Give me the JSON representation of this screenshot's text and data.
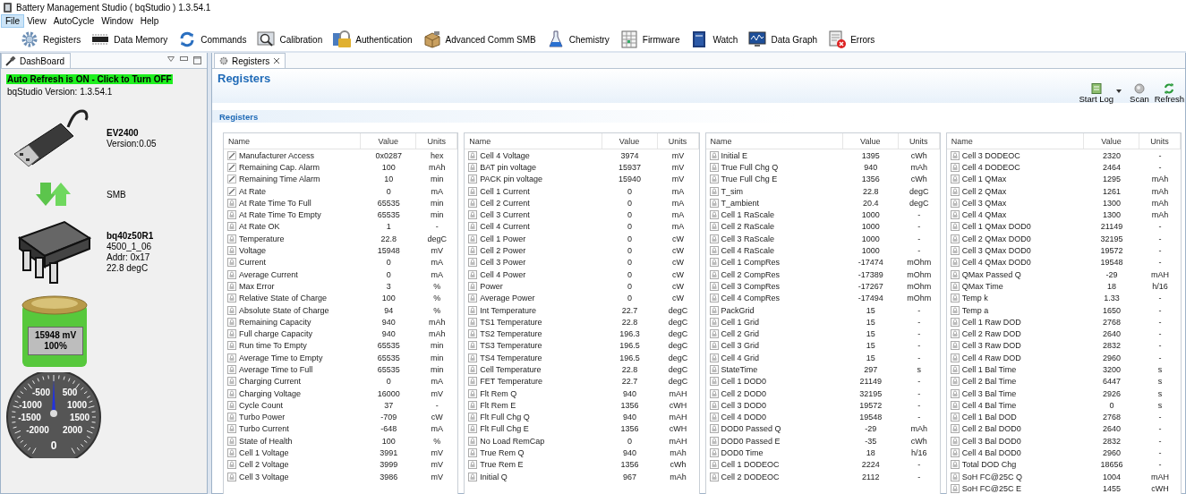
{
  "window": {
    "title": "Battery Management Studio ( bqStudio ) 1.3.54.1"
  },
  "menu": [
    {
      "label": "File",
      "highlighted": true
    },
    {
      "label": "View",
      "highlighted": false
    },
    {
      "label": "AutoCycle",
      "highlighted": false
    },
    {
      "label": "Window",
      "highlighted": false
    },
    {
      "label": "Help",
      "highlighted": false
    }
  ],
  "toolbar": [
    "Registers",
    "Data Memory",
    "Commands",
    "Calibration",
    "Authentication",
    "Advanced Comm SMB",
    "Chemistry",
    "Firmware",
    "Watch",
    "Data Graph",
    "Errors"
  ],
  "dashboard": {
    "tab": "DashBoard",
    "auto_refresh": "Auto Refresh is ON - Click to Turn OFF",
    "version": "bqStudio Version:  1.3.54.1",
    "adapter": {
      "name": "EV2400",
      "version": "Version:0.05"
    },
    "bus": "SMB",
    "device": {
      "name": "bq40z50R1",
      "lines": [
        "4500_1_06",
        "Addr: 0x17",
        "22.8 degC"
      ]
    },
    "battery": {
      "voltage": "15948 mV",
      "percent": "100%",
      "level": 1
    },
    "gauge": {
      "labels": [
        "-500",
        "500",
        "-1000",
        "1000",
        "-1500",
        "1500",
        "-2000",
        "2000"
      ],
      "reading": "0"
    }
  },
  "editor": {
    "tab": "Registers",
    "heading": "Registers",
    "actions": [
      "Start Log",
      "Scan",
      "Refresh"
    ],
    "section": "Registers",
    "tables": [
      {
        "columns": [
          "Name",
          "Value",
          "Units"
        ],
        "rows": [
          {
            "kind": "writable",
            "name": "Manufacturer Access",
            "value": "0x0287",
            "units": "hex"
          },
          {
            "kind": "writable",
            "name": "Remaining Cap. Alarm",
            "value": "100",
            "units": "mAh"
          },
          {
            "kind": "writable",
            "name": "Remaining Time Alarm",
            "value": "10",
            "units": "min"
          },
          {
            "kind": "writable",
            "name": "At Rate",
            "value": "0",
            "units": "mA"
          },
          {
            "kind": "readonly",
            "name": "At Rate Time To Full",
            "value": "65535",
            "units": "min"
          },
          {
            "kind": "readonly",
            "name": "At Rate Time To Empty",
            "value": "65535",
            "units": "min"
          },
          {
            "kind": "readonly",
            "name": "At Rate OK",
            "value": "1",
            "units": "-"
          },
          {
            "kind": "readonly",
            "name": "Temperature",
            "value": "22.8",
            "units": "degC"
          },
          {
            "kind": "readonly",
            "name": "Voltage",
            "value": "15948",
            "units": "mV"
          },
          {
            "kind": "readonly",
            "name": "Current",
            "value": "0",
            "units": "mA"
          },
          {
            "kind": "readonly",
            "name": "Average Current",
            "value": "0",
            "units": "mA"
          },
          {
            "kind": "readonly",
            "name": "Max Error",
            "value": "3",
            "units": "%"
          },
          {
            "kind": "readonly",
            "name": "Relative State of Charge",
            "value": "100",
            "units": "%"
          },
          {
            "kind": "readonly",
            "name": "Absolute State of Charge",
            "value": "94",
            "units": "%"
          },
          {
            "kind": "readonly",
            "name": "Remaining Capacity",
            "value": "940",
            "units": "mAh"
          },
          {
            "kind": "readonly",
            "name": "Full charge Capacity",
            "value": "940",
            "units": "mAh"
          },
          {
            "kind": "readonly",
            "name": "Run time To Empty",
            "value": "65535",
            "units": "min"
          },
          {
            "kind": "readonly",
            "name": "Average Time to Empty",
            "value": "65535",
            "units": "min"
          },
          {
            "kind": "readonly",
            "name": "Average Time to Full",
            "value": "65535",
            "units": "min"
          },
          {
            "kind": "readonly",
            "name": "Charging Current",
            "value": "0",
            "units": "mA"
          },
          {
            "kind": "readonly",
            "name": "Charging Voltage",
            "value": "16000",
            "units": "mV"
          },
          {
            "kind": "readonly",
            "name": "Cycle Count",
            "value": "37",
            "units": "-"
          },
          {
            "kind": "readonly",
            "name": "Turbo Power",
            "value": "-709",
            "units": "cW"
          },
          {
            "kind": "readonly",
            "name": "Turbo Current",
            "value": "-648",
            "units": "mA"
          },
          {
            "kind": "readonly",
            "name": "State of Health",
            "value": "100",
            "units": "%"
          },
          {
            "kind": "readonly",
            "name": "Cell 1 Voltage",
            "value": "3991",
            "units": "mV"
          },
          {
            "kind": "readonly",
            "name": "Cell 2 Voltage",
            "value": "3999",
            "units": "mV"
          },
          {
            "kind": "readonly",
            "name": "Cell 3 Voltage",
            "value": "3986",
            "units": "mV"
          }
        ]
      },
      {
        "columns": [
          "Name",
          "Value",
          "Units"
        ],
        "rows": [
          {
            "kind": "readonly",
            "name": "Cell 4 Voltage",
            "value": "3974",
            "units": "mV"
          },
          {
            "kind": "readonly",
            "name": "BAT pin voltage",
            "value": "15937",
            "units": "mV"
          },
          {
            "kind": "readonly",
            "name": "PACK pin voltage",
            "value": "15940",
            "units": "mV"
          },
          {
            "kind": "readonly",
            "name": "Cell 1 Current",
            "value": "0",
            "units": "mA"
          },
          {
            "kind": "readonly",
            "name": "Cell 2 Current",
            "value": "0",
            "units": "mA"
          },
          {
            "kind": "readonly",
            "name": "Cell 3 Current",
            "value": "0",
            "units": "mA"
          },
          {
            "kind": "readonly",
            "name": "Cell 4 Current",
            "value": "0",
            "units": "mA"
          },
          {
            "kind": "readonly",
            "name": "Cell 1 Power",
            "value": "0",
            "units": "cW"
          },
          {
            "kind": "readonly",
            "name": "Cell 2 Power",
            "value": "0",
            "units": "cW"
          },
          {
            "kind": "readonly",
            "name": "Cell 3 Power",
            "value": "0",
            "units": "cW"
          },
          {
            "kind": "readonly",
            "name": "Cell 4 Power",
            "value": "0",
            "units": "cW"
          },
          {
            "kind": "readonly",
            "name": "Power",
            "value": "0",
            "units": "cW"
          },
          {
            "kind": "readonly",
            "name": "Average Power",
            "value": "0",
            "units": "cW"
          },
          {
            "kind": "readonly",
            "name": "Int Temperature",
            "value": "22.7",
            "units": "degC"
          },
          {
            "kind": "readonly",
            "name": "TS1 Temperature",
            "value": "22.8",
            "units": "degC"
          },
          {
            "kind": "readonly",
            "name": "TS2 Temperature",
            "value": "196.3",
            "units": "degC"
          },
          {
            "kind": "readonly",
            "name": "TS3 Temperature",
            "value": "196.5",
            "units": "degC"
          },
          {
            "kind": "readonly",
            "name": "TS4 Temperature",
            "value": "196.5",
            "units": "degC"
          },
          {
            "kind": "readonly",
            "name": "Cell Temperature",
            "value": "22.8",
            "units": "degC"
          },
          {
            "kind": "readonly",
            "name": "FET Temperature",
            "value": "22.7",
            "units": "degC"
          },
          {
            "kind": "readonly",
            "name": "Flt Rem Q",
            "value": "940",
            "units": "mAH"
          },
          {
            "kind": "readonly",
            "name": "Flt Rem E",
            "value": "1356",
            "units": "cWH"
          },
          {
            "kind": "readonly",
            "name": "Flt Full Chg Q",
            "value": "940",
            "units": "mAH"
          },
          {
            "kind": "readonly",
            "name": "Flt Full Chg E",
            "value": "1356",
            "units": "cWH"
          },
          {
            "kind": "readonly",
            "name": "No Load RemCap",
            "value": "0",
            "units": "mAH"
          },
          {
            "kind": "readonly",
            "name": "True Rem Q",
            "value": "940",
            "units": "mAh"
          },
          {
            "kind": "readonly",
            "name": "True Rem E",
            "value": "1356",
            "units": "cWh"
          },
          {
            "kind": "readonly",
            "name": "Initial Q",
            "value": "967",
            "units": "mAh"
          }
        ]
      },
      {
        "columns": [
          "Name",
          "Value",
          "Units"
        ],
        "rows": [
          {
            "kind": "readonly",
            "name": "Initial E",
            "value": "1395",
            "units": "cWh"
          },
          {
            "kind": "readonly",
            "name": "True Full Chg Q",
            "value": "940",
            "units": "mAh"
          },
          {
            "kind": "readonly",
            "name": "True Full Chg E",
            "value": "1356",
            "units": "cWh"
          },
          {
            "kind": "readonly",
            "name": "T_sim",
            "value": "22.8",
            "units": "degC"
          },
          {
            "kind": "readonly",
            "name": "T_ambient",
            "value": "20.4",
            "units": "degC"
          },
          {
            "kind": "readonly",
            "name": "Cell 1 RaScale",
            "value": "1000",
            "units": "-"
          },
          {
            "kind": "readonly",
            "name": "Cell 2 RaScale",
            "value": "1000",
            "units": "-"
          },
          {
            "kind": "readonly",
            "name": "Cell 3 RaScale",
            "value": "1000",
            "units": "-"
          },
          {
            "kind": "readonly",
            "name": "Cell 4 RaScale",
            "value": "1000",
            "units": "-"
          },
          {
            "kind": "readonly",
            "name": "Cell 1 CompRes",
            "value": "-17474",
            "units": "mOhm"
          },
          {
            "kind": "readonly",
            "name": "Cell 2 CompRes",
            "value": "-17389",
            "units": "mOhm"
          },
          {
            "kind": "readonly",
            "name": "Cell 3 CompRes",
            "value": "-17267",
            "units": "mOhm"
          },
          {
            "kind": "readonly",
            "name": "Cell 4 CompRes",
            "value": "-17494",
            "units": "mOhm"
          },
          {
            "kind": "readonly",
            "name": "PackGrid",
            "value": "15",
            "units": "-"
          },
          {
            "kind": "readonly",
            "name": "Cell 1 Grid",
            "value": "15",
            "units": "-"
          },
          {
            "kind": "readonly",
            "name": "Cell 2 Grid",
            "value": "15",
            "units": "-"
          },
          {
            "kind": "readonly",
            "name": "Cell 3 Grid",
            "value": "15",
            "units": "-"
          },
          {
            "kind": "readonly",
            "name": "Cell 4 Grid",
            "value": "15",
            "units": "-"
          },
          {
            "kind": "readonly",
            "name": "StateTime",
            "value": "297",
            "units": "s"
          },
          {
            "kind": "readonly",
            "name": "Cell 1 DOD0",
            "value": "21149",
            "units": "-"
          },
          {
            "kind": "readonly",
            "name": "Cell 2 DOD0",
            "value": "32195",
            "units": "-"
          },
          {
            "kind": "readonly",
            "name": "Cell 3 DOD0",
            "value": "19572",
            "units": "-"
          },
          {
            "kind": "readonly",
            "name": "Cell 4 DOD0",
            "value": "19548",
            "units": "-"
          },
          {
            "kind": "readonly",
            "name": "DOD0 Passed Q",
            "value": "-29",
            "units": "mAh"
          },
          {
            "kind": "readonly",
            "name": "DOD0 Passed E",
            "value": "-35",
            "units": "cWh"
          },
          {
            "kind": "readonly",
            "name": "DOD0 Time",
            "value": "18",
            "units": "h/16"
          },
          {
            "kind": "readonly",
            "name": "Cell 1 DODEOC",
            "value": "2224",
            "units": "-"
          },
          {
            "kind": "readonly",
            "name": "Cell 2 DODEOC",
            "value": "2112",
            "units": "-"
          }
        ]
      },
      {
        "columns": [
          "Name",
          "Value",
          "Units"
        ],
        "rows": [
          {
            "kind": "readonly",
            "name": "Cell 3 DODEOC",
            "value": "2320",
            "units": "-"
          },
          {
            "kind": "readonly",
            "name": "Cell 4 DODEOC",
            "value": "2464",
            "units": "-"
          },
          {
            "kind": "readonly",
            "name": "Cell 1 QMax",
            "value": "1295",
            "units": "mAh"
          },
          {
            "kind": "readonly",
            "name": "Cell 2 QMax",
            "value": "1261",
            "units": "mAh"
          },
          {
            "kind": "readonly",
            "name": "Cell 3 QMax",
            "value": "1300",
            "units": "mAh"
          },
          {
            "kind": "readonly",
            "name": "Cell 4 QMax",
            "value": "1300",
            "units": "mAh"
          },
          {
            "kind": "readonly",
            "name": "Cell 1 QMax DOD0",
            "value": "21149",
            "units": "-"
          },
          {
            "kind": "readonly",
            "name": "Cell 2 QMax DOD0",
            "value": "32195",
            "units": "-"
          },
          {
            "kind": "readonly",
            "name": "Cell 3 QMax DOD0",
            "value": "19572",
            "units": "-"
          },
          {
            "kind": "readonly",
            "name": "Cell 4 QMax DOD0",
            "value": "19548",
            "units": "-"
          },
          {
            "kind": "readonly",
            "name": "QMax Passed Q",
            "value": "-29",
            "units": "mAH"
          },
          {
            "kind": "readonly",
            "name": "QMax Time",
            "value": "18",
            "units": "h/16"
          },
          {
            "kind": "readonly",
            "name": "Temp k",
            "value": "1.33",
            "units": "-"
          },
          {
            "kind": "readonly",
            "name": "Temp a",
            "value": "1650",
            "units": "-"
          },
          {
            "kind": "readonly",
            "name": "Cell 1 Raw DOD",
            "value": "2768",
            "units": "-"
          },
          {
            "kind": "readonly",
            "name": "Cell 2 Raw DOD",
            "value": "2640",
            "units": "-"
          },
          {
            "kind": "readonly",
            "name": "Cell 3 Raw DOD",
            "value": "2832",
            "units": "-"
          },
          {
            "kind": "readonly",
            "name": "Cell 4 Raw DOD",
            "value": "2960",
            "units": "-"
          },
          {
            "kind": "readonly",
            "name": "Cell 1 Bal Time",
            "value": "3200",
            "units": "s"
          },
          {
            "kind": "readonly",
            "name": "Cell 2 Bal Time",
            "value": "6447",
            "units": "s"
          },
          {
            "kind": "readonly",
            "name": "Cell 3 Bal Time",
            "value": "2926",
            "units": "s"
          },
          {
            "kind": "readonly",
            "name": "Cell 4 Bal Time",
            "value": "0",
            "units": "s"
          },
          {
            "kind": "readonly",
            "name": "Cell 1 Bal DOD",
            "value": "2768",
            "units": "-"
          },
          {
            "kind": "readonly",
            "name": "Cell 2 Bal DOD0",
            "value": "2640",
            "units": "-"
          },
          {
            "kind": "readonly",
            "name": "Cell 3 Bal DOD0",
            "value": "2832",
            "units": "-"
          },
          {
            "kind": "readonly",
            "name": "Cell 4 Bal DOD0",
            "value": "2960",
            "units": "-"
          },
          {
            "kind": "readonly",
            "name": "Total DOD Chg",
            "value": "18656",
            "units": "-"
          },
          {
            "kind": "readonly",
            "name": "SoH FC@25C Q",
            "value": "1004",
            "units": "mAH"
          },
          {
            "kind": "readonly",
            "name": "SoH FC@25C E",
            "value": "1455",
            "units": "cWH"
          }
        ]
      }
    ]
  }
}
